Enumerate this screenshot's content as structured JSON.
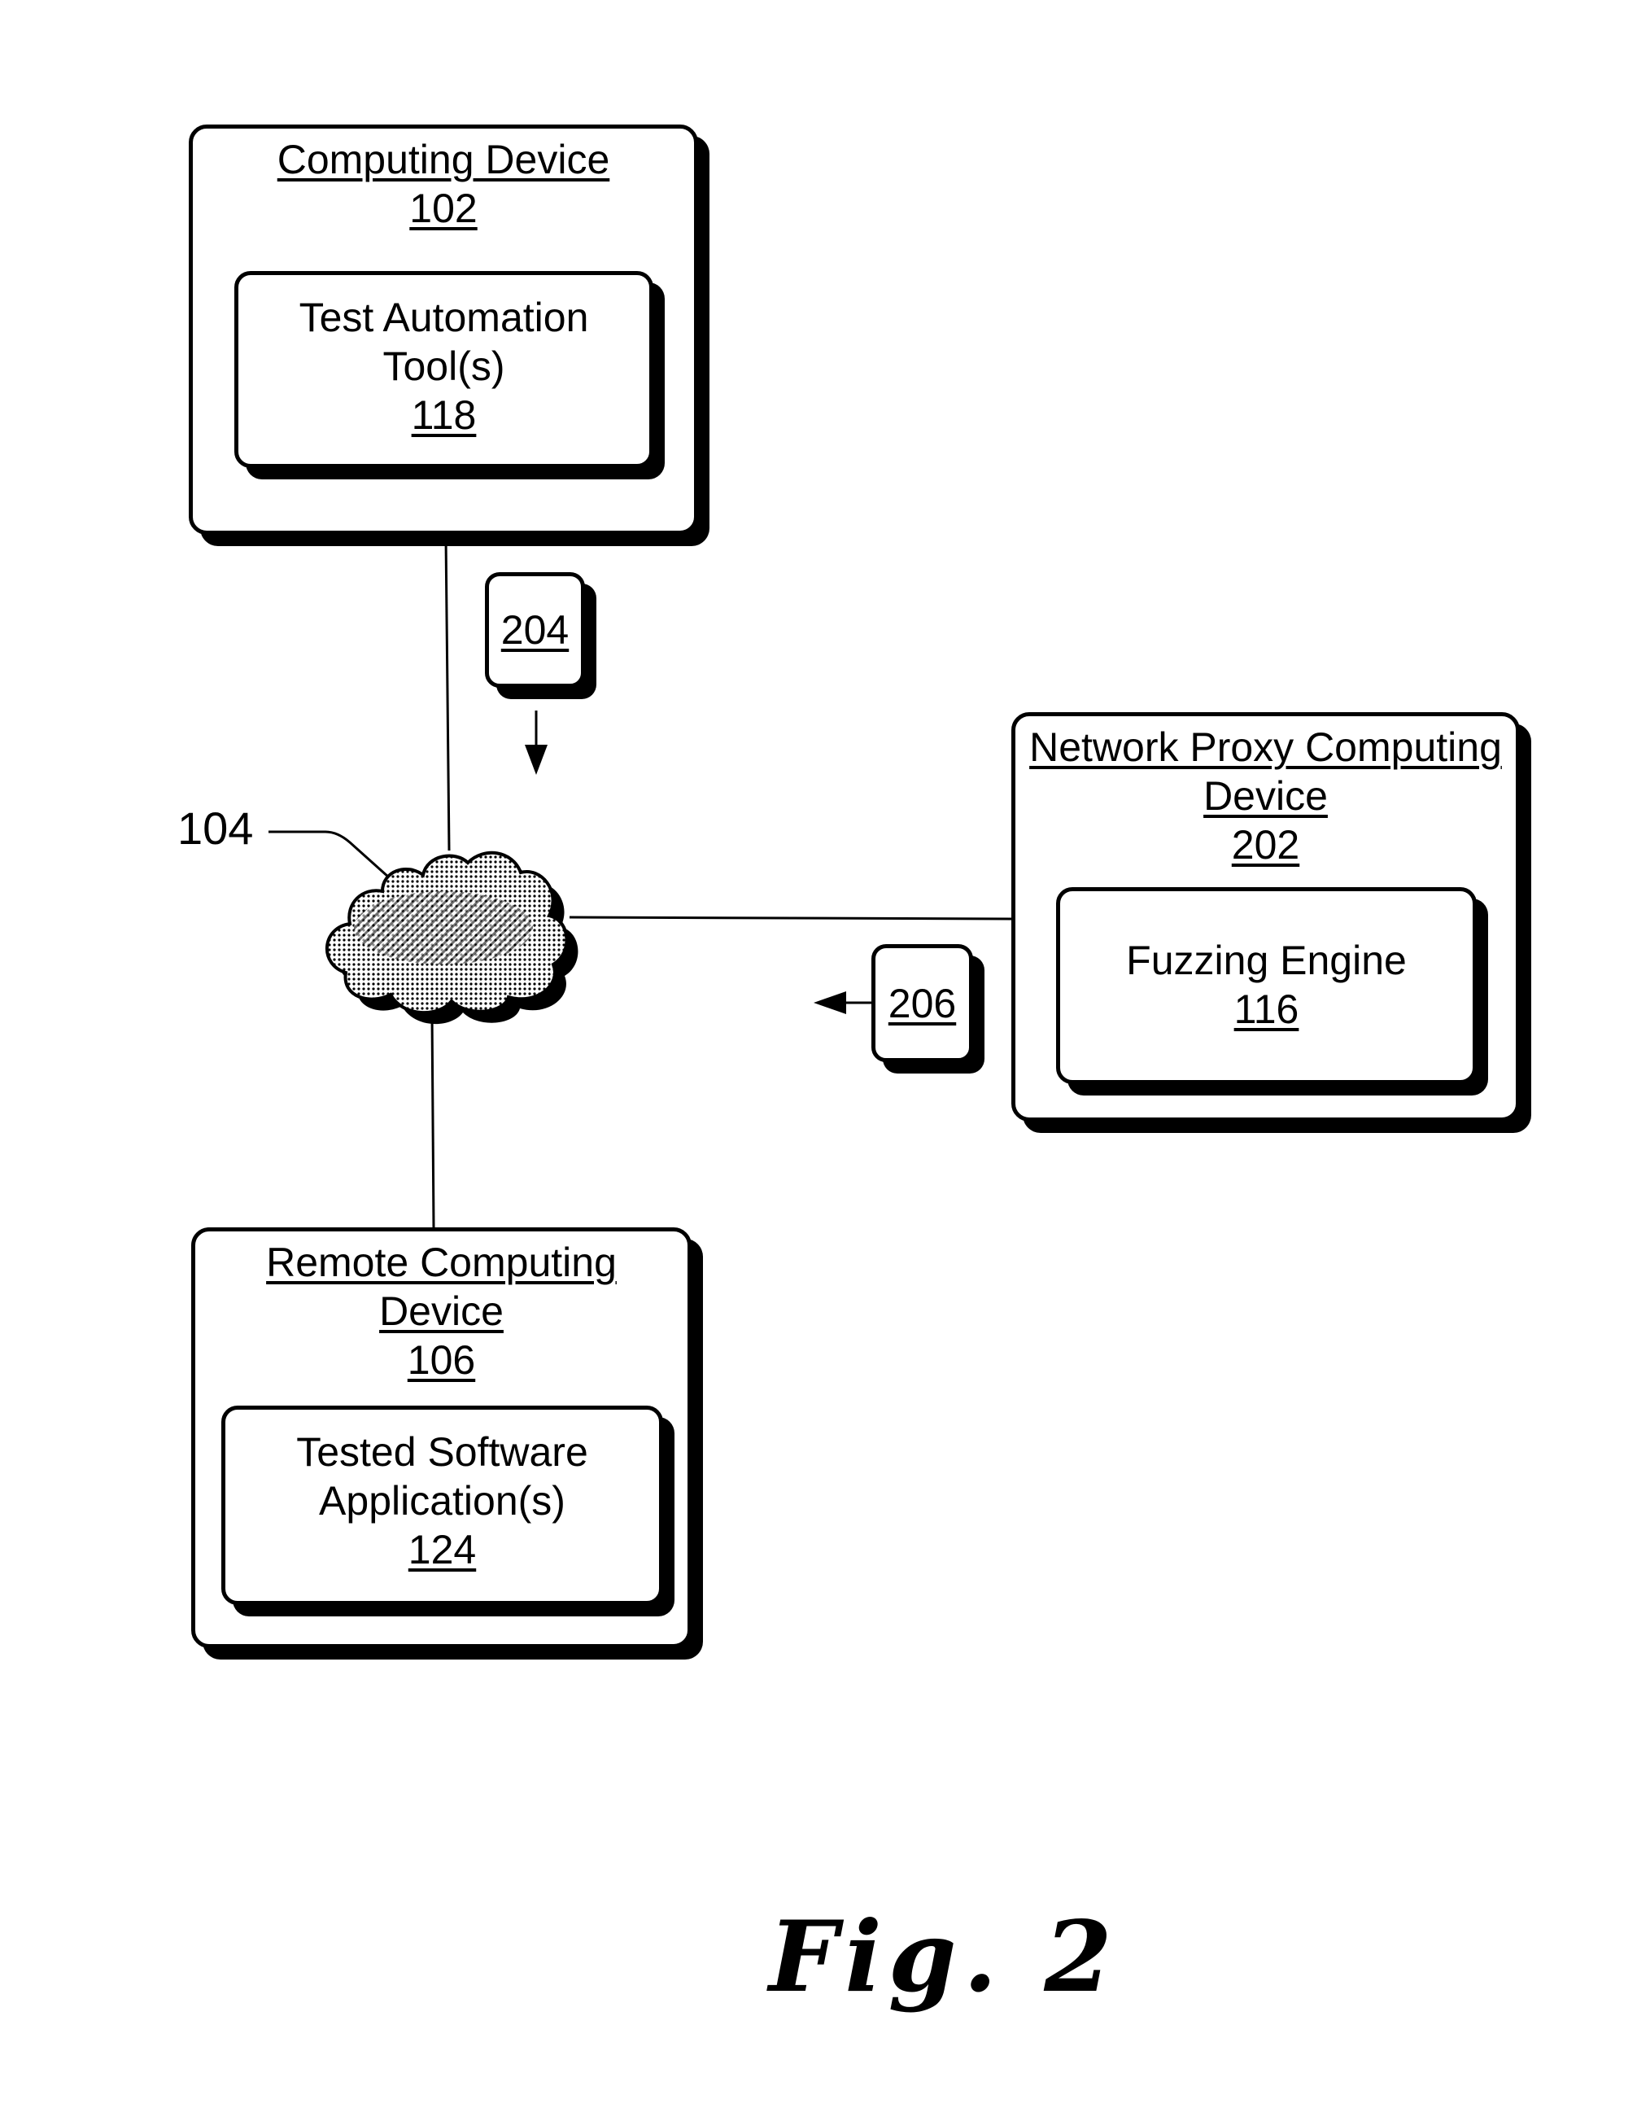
{
  "figure": {
    "caption": "Fig. 2"
  },
  "nodes": {
    "computing_device": {
      "title": "Computing Device",
      "ref": "102",
      "child": {
        "lines": [
          "Test Automation",
          "Tool(s)"
        ],
        "ref": "118"
      }
    },
    "network": {
      "ref": "104",
      "icon": "cloud-icon"
    },
    "network_proxy": {
      "title_lines": [
        "Network Proxy Computing",
        "Device"
      ],
      "ref": "202",
      "child": {
        "lines": [
          "Fuzzing Engine"
        ],
        "ref": "116"
      }
    },
    "remote_device": {
      "title_lines": [
        "Remote Computing",
        "Device"
      ],
      "ref": "106",
      "child": {
        "lines": [
          "Tested Software",
          "Application(s)"
        ],
        "ref": "124"
      }
    }
  },
  "flows": {
    "f204": {
      "ref": "204",
      "direction": "down",
      "from": "Computing Device 102",
      "to": "Network 104"
    },
    "f206": {
      "ref": "206",
      "direction": "left",
      "from": "Network Proxy Computing Device 202",
      "to": "Network 104"
    }
  },
  "connections": [
    {
      "from": "Computing Device 102",
      "to": "Network 104"
    },
    {
      "from": "Network 104",
      "to": "Network Proxy Computing Device 202"
    },
    {
      "from": "Network 104",
      "to": "Remote Computing Device 106"
    }
  ]
}
